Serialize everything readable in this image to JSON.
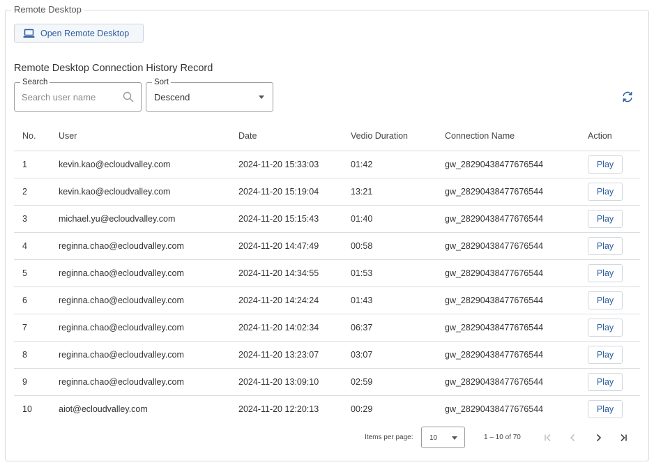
{
  "panel": {
    "title": "Remote Desktop"
  },
  "open_button": {
    "label": "Open Remote Desktop",
    "icon": "laptop-icon"
  },
  "section_title": "Remote Desktop Connection History Record",
  "search": {
    "label": "Search",
    "placeholder": "Search user name",
    "value": ""
  },
  "sort": {
    "label": "Sort",
    "value": "Descend"
  },
  "table": {
    "columns": [
      "No.",
      "User",
      "Date",
      "Vedio Duration",
      "Connection Name",
      "Action"
    ],
    "rows": [
      {
        "no": "1",
        "user": "kevin.kao@ecloudvalley.com",
        "date": "2024-11-20 15:33:03",
        "duration": "01:42",
        "connection": "gw_28290438477676544",
        "action": "Play"
      },
      {
        "no": "2",
        "user": "kevin.kao@ecloudvalley.com",
        "date": "2024-11-20 15:19:04",
        "duration": "13:21",
        "connection": "gw_28290438477676544",
        "action": "Play"
      },
      {
        "no": "3",
        "user": "michael.yu@ecloudvalley.com",
        "date": "2024-11-20 15:15:43",
        "duration": "01:40",
        "connection": "gw_28290438477676544",
        "action": "Play"
      },
      {
        "no": "4",
        "user": "reginna.chao@ecloudvalley.com",
        "date": "2024-11-20 14:47:49",
        "duration": "00:58",
        "connection": "gw_28290438477676544",
        "action": "Play"
      },
      {
        "no": "5",
        "user": "reginna.chao@ecloudvalley.com",
        "date": "2024-11-20 14:34:55",
        "duration": "01:53",
        "connection": "gw_28290438477676544",
        "action": "Play"
      },
      {
        "no": "6",
        "user": "reginna.chao@ecloudvalley.com",
        "date": "2024-11-20 14:24:24",
        "duration": "01:43",
        "connection": "gw_28290438477676544",
        "action": "Play"
      },
      {
        "no": "7",
        "user": "reginna.chao@ecloudvalley.com",
        "date": "2024-11-20 14:02:34",
        "duration": "06:37",
        "connection": "gw_28290438477676544",
        "action": "Play"
      },
      {
        "no": "8",
        "user": "reginna.chao@ecloudvalley.com",
        "date": "2024-11-20 13:23:07",
        "duration": "03:07",
        "connection": "gw_28290438477676544",
        "action": "Play"
      },
      {
        "no": "9",
        "user": "reginna.chao@ecloudvalley.com",
        "date": "2024-11-20 13:09:10",
        "duration": "02:59",
        "connection": "gw_28290438477676544",
        "action": "Play"
      },
      {
        "no": "10",
        "user": "aiot@ecloudvalley.com",
        "date": "2024-11-20 12:20:13",
        "duration": "00:29",
        "connection": "gw_28290438477676544",
        "action": "Play"
      }
    ]
  },
  "paginator": {
    "items_per_page_label": "Items per page:",
    "items_per_page": "10",
    "range": "1 – 10 of 70",
    "buttons": [
      "first-page-icon",
      "previous-page-icon",
      "next-page-icon",
      "last-page-icon"
    ]
  },
  "colors": {
    "accent": "#2b5d9e",
    "border": "#dddddd",
    "disabled": "#c4c4c4"
  }
}
